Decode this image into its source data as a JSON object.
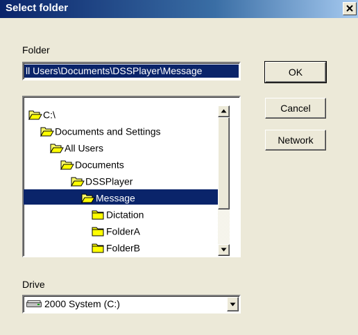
{
  "window": {
    "title": "Select folder",
    "close_icon": "close-icon"
  },
  "folder": {
    "label": "Folder",
    "value": "ll Users\\Documents\\DSSPlayer\\Message"
  },
  "buttons": {
    "ok": "OK",
    "cancel": "Cancel",
    "network": "Network"
  },
  "tree": {
    "items": [
      {
        "label": "C:\\",
        "icon": "open-folder-icon",
        "selected": false
      },
      {
        "label": "Documents and Settings",
        "icon": "open-folder-icon",
        "selected": false
      },
      {
        "label": "All Users",
        "icon": "open-folder-icon",
        "selected": false
      },
      {
        "label": "Documents",
        "icon": "open-folder-icon",
        "selected": false
      },
      {
        "label": "DSSPlayer",
        "icon": "open-folder-icon",
        "selected": false
      },
      {
        "label": "Message",
        "icon": "open-folder-icon",
        "selected": true
      },
      {
        "label": "Dictation",
        "icon": "folder-icon",
        "selected": false
      },
      {
        "label": "FolderA",
        "icon": "folder-icon",
        "selected": false
      },
      {
        "label": "FolderB",
        "icon": "folder-icon",
        "selected": false
      }
    ]
  },
  "drive": {
    "label": "Drive",
    "value": "2000 System (C:)",
    "icon": "hard-drive-icon"
  },
  "colors": {
    "selection": "#0a246a",
    "dialog_background": "#ece9d8",
    "folder_yellow": "#ffff00"
  }
}
